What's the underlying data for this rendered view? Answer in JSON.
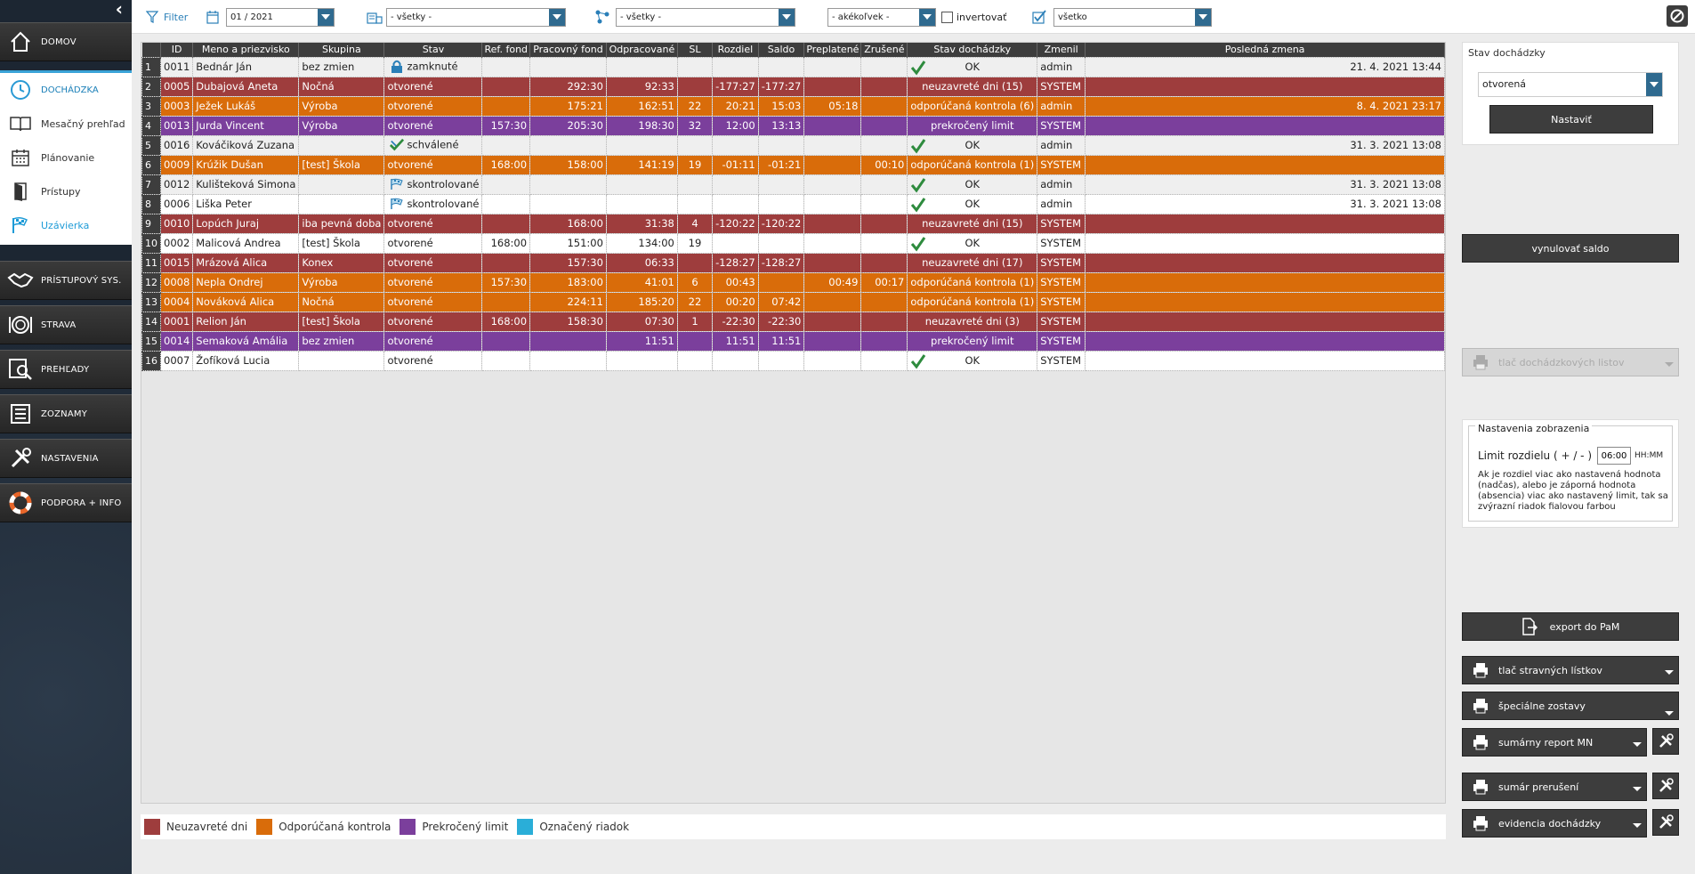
{
  "sidebar": {
    "home": "DOMOV",
    "dochadzka": "DOCHÁDZKA",
    "sub_items": [
      "Mesačný prehľad",
      "Plánovanie",
      "Prístupy",
      "Uzávierka"
    ],
    "access": "PRÍSTUPOVÝ SYS.",
    "strava": "STRAVA",
    "prehlady": "PREHĽADY",
    "zoznamy": "ZOZNAMY",
    "nastavenia": "NASTAVENIA",
    "podpora": "PODPORA + INFO"
  },
  "filter": {
    "label": "Filter",
    "period": "01 / 2021",
    "department": "- všetky -",
    "group": "- všetky -",
    "state": "- akékoľvek -",
    "invert_label": "invertovať",
    "show": "všetko"
  },
  "columns": [
    "ID",
    "Meno a priezvisko",
    "Skupina",
    "Stav",
    "Ref. fond",
    "Pracovný fond",
    "Odpracované",
    "SL",
    "Rozdiel",
    "Saldo",
    "Preplatené",
    "Zrušené",
    "Stav dochádzky",
    "Zmenil",
    "Posledná zmena"
  ],
  "rows": [
    {
      "n": "1",
      "id": "0011",
      "name": "Bednár Ján",
      "group": "bez zmien",
      "state": "zamknuté",
      "state_icon": "lock",
      "ref": "",
      "fond": "",
      "odp": "",
      "sl": "",
      "rozdiel": "",
      "saldo": "",
      "prepl": "",
      "zrus": "",
      "ok": true,
      "doch": "OK",
      "zmenil": "admin",
      "zmena": "21. 4. 2021 13:44",
      "color": "gray"
    },
    {
      "n": "2",
      "id": "0005",
      "name": "Dubajová Aneta",
      "group": "Nočná",
      "state": "otvorené",
      "state_icon": "",
      "ref": "",
      "fond": "292:30",
      "odp": "92:33",
      "sl": "",
      "rozdiel": "-177:27",
      "saldo": "-177:27",
      "prepl": "",
      "zrus": "",
      "ok": false,
      "doch": "neuzavreté dni (15)",
      "zmenil": "SYSTEM",
      "zmena": "",
      "color": "red"
    },
    {
      "n": "3",
      "id": "0003",
      "name": "Ježek Lukáš",
      "group": "Výroba",
      "state": "otvorené",
      "state_icon": "",
      "ref": "",
      "fond": "175:21",
      "odp": "162:51",
      "sl": "22",
      "rozdiel": "20:21",
      "saldo": "15:03",
      "prepl": "05:18",
      "zrus": "",
      "ok": false,
      "doch": "odporúčaná kontrola (6)",
      "zmenil": "admin",
      "zmena": "8. 4. 2021 23:17",
      "color": "orange"
    },
    {
      "n": "4",
      "id": "0013",
      "name": "Jurda Vincent",
      "group": "Výroba",
      "state": "otvorené",
      "state_icon": "",
      "ref": "157:30",
      "fond": "205:30",
      "odp": "198:30",
      "sl": "32",
      "rozdiel": "12:00",
      "saldo": "13:13",
      "prepl": "",
      "zrus": "",
      "ok": false,
      "doch": "prekročený limit",
      "zmenil": "SYSTEM",
      "zmena": "",
      "color": "purple"
    },
    {
      "n": "5",
      "id": "0016",
      "name": "Kováčiková Zuzana",
      "group": "",
      "state": "schválené",
      "state_icon": "approved",
      "ref": "",
      "fond": "",
      "odp": "",
      "sl": "",
      "rozdiel": "",
      "saldo": "",
      "prepl": "",
      "zrus": "",
      "ok": true,
      "doch": "OK",
      "zmenil": "admin",
      "zmena": "31. 3. 2021 13:08",
      "color": "gray"
    },
    {
      "n": "6",
      "id": "0009",
      "name": "Krúžik Dušan",
      "group": "[test] Škola",
      "state": "otvorené",
      "state_icon": "",
      "ref": "168:00",
      "fond": "158:00",
      "odp": "141:19",
      "sl": "19",
      "rozdiel": "-01:11",
      "saldo": "-01:21",
      "prepl": "",
      "zrus": "00:10",
      "ok": false,
      "doch": "odporúčaná kontrola (1)",
      "zmenil": "SYSTEM",
      "zmena": "",
      "color": "orange"
    },
    {
      "n": "7",
      "id": "0012",
      "name": "Kulišteková Simona",
      "group": "",
      "state": "skontrolované",
      "state_icon": "flag",
      "ref": "",
      "fond": "",
      "odp": "",
      "sl": "",
      "rozdiel": "",
      "saldo": "",
      "prepl": "",
      "zrus": "",
      "ok": true,
      "doch": "OK",
      "zmenil": "admin",
      "zmena": "31. 3. 2021 13:08",
      "color": "gray"
    },
    {
      "n": "8",
      "id": "0006",
      "name": "Liška Peter",
      "group": "",
      "state": "skontrolované",
      "state_icon": "flag",
      "ref": "",
      "fond": "",
      "odp": "",
      "sl": "",
      "rozdiel": "",
      "saldo": "",
      "prepl": "",
      "zrus": "",
      "ok": true,
      "doch": "OK",
      "zmenil": "admin",
      "zmena": "31. 3. 2021 13:08",
      "color": "white"
    },
    {
      "n": "9",
      "id": "0010",
      "name": "Lopúch Juraj",
      "group": "iba pevná doba",
      "state": "otvorené",
      "state_icon": "",
      "ref": "",
      "fond": "168:00",
      "odp": "31:38",
      "sl": "4",
      "rozdiel": "-120:22",
      "saldo": "-120:22",
      "prepl": "",
      "zrus": "",
      "ok": false,
      "doch": "neuzavreté dni (15)",
      "zmenil": "SYSTEM",
      "zmena": "",
      "color": "red"
    },
    {
      "n": "10",
      "id": "0002",
      "name": "Malicová Andrea",
      "group": "[test] Škola",
      "state": "otvorené",
      "state_icon": "",
      "ref": "168:00",
      "fond": "151:00",
      "odp": "134:00",
      "sl": "19",
      "rozdiel": "",
      "saldo": "",
      "prepl": "",
      "zrus": "",
      "ok": true,
      "doch": "OK",
      "zmenil": "SYSTEM",
      "zmena": "",
      "color": "white"
    },
    {
      "n": "11",
      "id": "0015",
      "name": "Mrázová Alica",
      "group": "Konex",
      "state": "otvorené",
      "state_icon": "",
      "ref": "",
      "fond": "157:30",
      "odp": "06:33",
      "sl": "",
      "rozdiel": "-128:27",
      "saldo": "-128:27",
      "prepl": "",
      "zrus": "",
      "ok": false,
      "doch": "neuzavreté dni (17)",
      "zmenil": "SYSTEM",
      "zmena": "",
      "color": "red"
    },
    {
      "n": "12",
      "id": "0008",
      "name": "Nepla Ondrej",
      "group": "Výroba",
      "state": "otvorené",
      "state_icon": "",
      "ref": "157:30",
      "fond": "183:00",
      "odp": "41:01",
      "sl": "6",
      "rozdiel": "00:43",
      "saldo": "",
      "prepl": "00:49",
      "zrus": "00:17",
      "ok": false,
      "doch": "odporúčaná kontrola (1)",
      "zmenil": "SYSTEM",
      "zmena": "",
      "color": "orange"
    },
    {
      "n": "13",
      "id": "0004",
      "name": "Nováková Alica",
      "group": "Nočná",
      "state": "otvorené",
      "state_icon": "",
      "ref": "",
      "fond": "224:11",
      "odp": "185:20",
      "sl": "22",
      "rozdiel": "00:20",
      "saldo": "07:42",
      "prepl": "",
      "zrus": "",
      "ok": false,
      "doch": "odporúčaná kontrola (1)",
      "zmenil": "SYSTEM",
      "zmena": "",
      "color": "orange"
    },
    {
      "n": "14",
      "id": "0001",
      "name": "Relion Ján",
      "group": "[test] Škola",
      "state": "otvorené",
      "state_icon": "",
      "ref": "168:00",
      "fond": "158:30",
      "odp": "07:30",
      "sl": "1",
      "rozdiel": "-22:30",
      "saldo": "-22:30",
      "prepl": "",
      "zrus": "",
      "ok": false,
      "doch": "neuzavreté dni (3)",
      "zmenil": "SYSTEM",
      "zmena": "",
      "color": "red"
    },
    {
      "n": "15",
      "id": "0014",
      "name": "Semaková Amália",
      "group": "bez zmien",
      "state": "otvorené",
      "state_icon": "",
      "ref": "",
      "fond": "",
      "odp": "11:51",
      "sl": "",
      "rozdiel": "11:51",
      "saldo": "11:51",
      "prepl": "",
      "zrus": "",
      "ok": false,
      "doch": "prekročený limit",
      "zmenil": "SYSTEM",
      "zmena": "",
      "color": "purple"
    },
    {
      "n": "16",
      "id": "0007",
      "name": "Žofíková Lucia",
      "group": "",
      "state": "otvorené",
      "state_icon": "",
      "ref": "",
      "fond": "",
      "odp": "",
      "sl": "",
      "rozdiel": "",
      "saldo": "",
      "prepl": "",
      "zrus": "",
      "ok": true,
      "doch": "OK",
      "zmenil": "SYSTEM",
      "zmena": "",
      "color": "white"
    }
  ],
  "legend": [
    {
      "label": "Neuzavreté dni",
      "color": "#9e3d3d"
    },
    {
      "label": "Odporúčaná kontrola",
      "color": "#d96c0a"
    },
    {
      "label": "Prekročený limit",
      "color": "#7b3f9c"
    },
    {
      "label": "Označený riadok",
      "color": "#2aaed8"
    }
  ],
  "right": {
    "stav_title": "Stav dochádzky",
    "stav_value": "otvorená",
    "set_btn": "Nastaviť",
    "reset_btn": "vynulovať saldo",
    "print_sheets": "tlač dochádzkových listov",
    "display_title": "Nastavenia zobrazenia",
    "limit_label": "Limit rozdielu ( + / - )",
    "limit_value": "06:00",
    "limit_unit": "HH:MM",
    "limit_note": "Ak je rozdiel viac ako nastavená hodnota (nadčas), alebo je záporná hodnota (absencia) viac ako nastavený limit, tak sa zvýrazní riadok fialovou farbou",
    "export": "export do PaM",
    "meal_print": "tlač stravných lístkov",
    "special": "špeciálne zostavy",
    "summary_mn": "sumárny report MN",
    "interrupt": "sumár prerušení",
    "evidence": "evidencia dochádzky"
  }
}
